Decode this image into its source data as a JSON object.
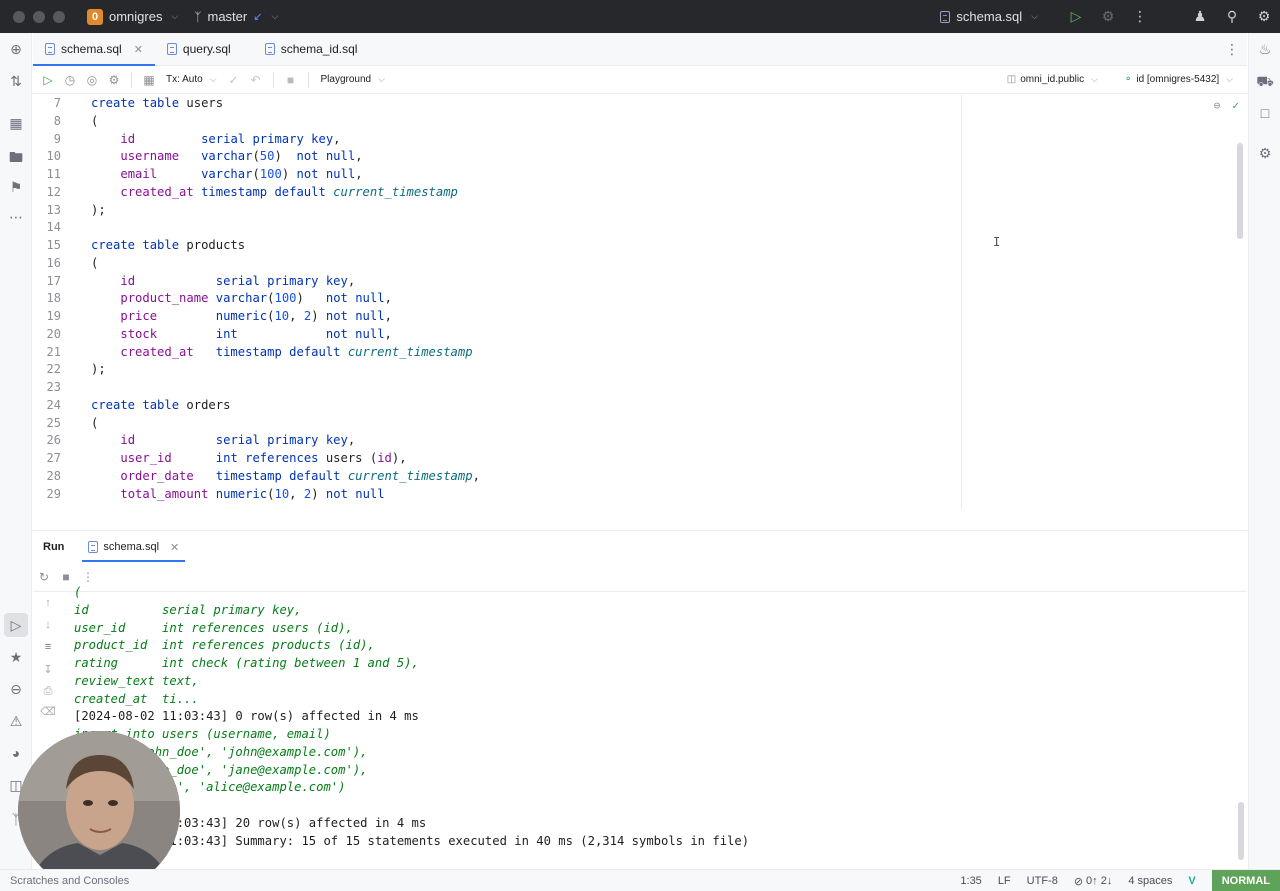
{
  "titlebar": {
    "project_badge": "0",
    "project_name": "omnigres",
    "branch": "master",
    "run_config": "schema.sql"
  },
  "tabs": [
    {
      "label": "schema.sql"
    },
    {
      "label": "query.sql"
    },
    {
      "label": "schema_id.sql"
    }
  ],
  "editor_toolbar": {
    "tx_mode": "Tx: Auto",
    "playground": "Playground",
    "schema": "omni_id.public",
    "datasource": "id [omnigres-5432]"
  },
  "editor": {
    "line_numbers": [
      "7",
      "8",
      "9",
      "10",
      "11",
      "12",
      "13",
      "14",
      "15",
      "16",
      "17",
      "18",
      "19",
      "20",
      "21",
      "22",
      "23",
      "24",
      "25",
      "26",
      "27",
      "28",
      "29"
    ]
  },
  "run_panel": {
    "label": "Run",
    "tab": "schema.sql"
  },
  "output": {
    "lines": [
      "(",
      "id          serial primary key,",
      "user_id     int references users (id),",
      "product_id  int references products (id),",
      "rating      int check (rating between 1 and 5),",
      "review_text text,",
      "created_at  ti...",
      "[2024-08-02 11:03:43] 0 row(s) affected in 4 ms",
      "insert into users (username, email)",
      "values ('john_doe', 'john@example.com'),",
      "       ('jane_doe', 'jane@example.com'),",
      "       ('alice', 'alice@example.com')",
      "",
      "[2024-08-02 11:03:43] 20 row(s) affected in 4 ms",
      "[2024-08-02 11:03:43] Summary: 15 of 15 statements executed in 40 ms (2,314 symbols in file)"
    ]
  },
  "statusbar": {
    "left": "Scratches and Consoles",
    "position": "1:35",
    "line_ending": "LF",
    "encoding": "UTF-8",
    "vcs": "0↑ 2↓",
    "indent": "4 spaces",
    "mode": "NORMAL"
  }
}
